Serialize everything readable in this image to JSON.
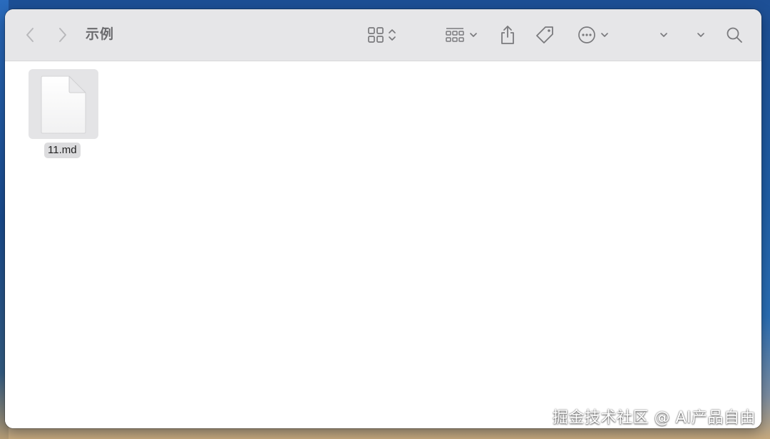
{
  "window": {
    "title": "示例"
  },
  "toolbar": {
    "back": {
      "icon": "chevron-left-icon",
      "enabled": false
    },
    "forward": {
      "icon": "chevron-right-icon",
      "enabled": false
    },
    "view_mode": {
      "icon": "grid-view-icon"
    },
    "group": {
      "icon": "group-by-icon"
    },
    "share": {
      "icon": "share-icon"
    },
    "tags": {
      "icon": "tag-icon"
    },
    "more": {
      "icon": "ellipsis-circle-icon"
    },
    "search": {
      "icon": "search-icon"
    }
  },
  "files": [
    {
      "name": "11.md",
      "selected": true,
      "icon": "document-icon"
    }
  ],
  "watermark": "掘金技术社区 @ AI产品自由",
  "colors": {
    "toolbar_bg": "#e6e6e8",
    "icon_color": "#7a7a7d",
    "disabled_icon": "#b8b8bb",
    "selection_bg": "#dcdcde"
  }
}
